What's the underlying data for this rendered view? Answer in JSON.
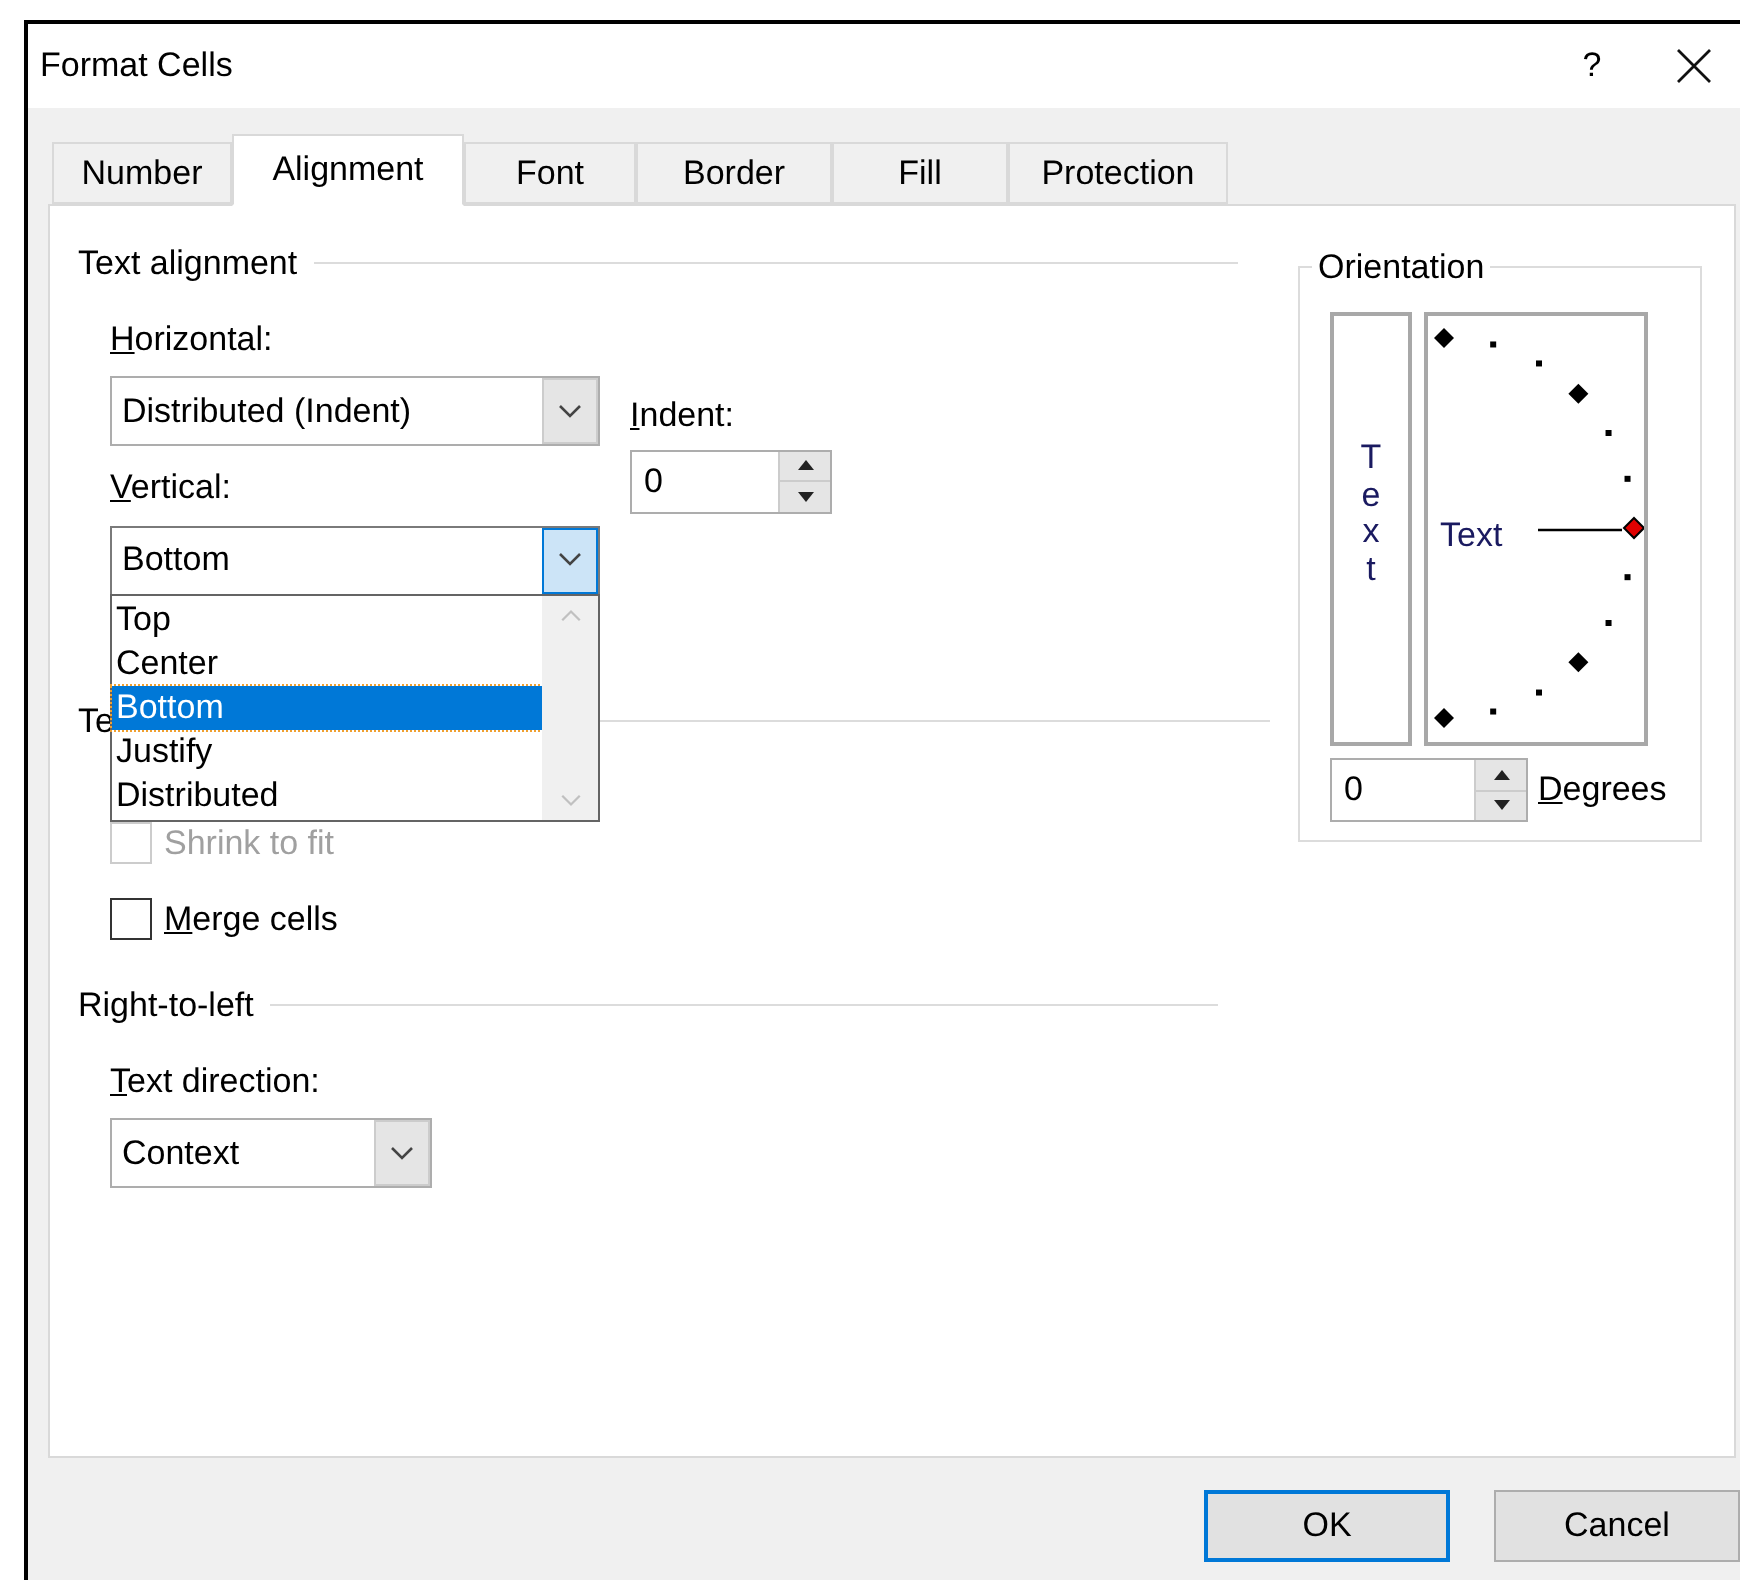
{
  "window": {
    "title": "Format Cells",
    "help": "?"
  },
  "tabs": [
    {
      "label": "Number",
      "selected": false
    },
    {
      "label": "Alignment",
      "selected": true
    },
    {
      "label": "Font",
      "selected": false
    },
    {
      "label": "Border",
      "selected": false
    },
    {
      "label": "Fill",
      "selected": false
    },
    {
      "label": "Protection",
      "selected": false
    }
  ],
  "text_alignment": {
    "heading": "Text alignment",
    "horizontal": {
      "label": {
        "key": "H",
        "rest": "orizontal:"
      },
      "value": "Distributed (Indent)"
    },
    "indent": {
      "label": {
        "key": "I",
        "rest": "ndent:"
      },
      "value": "0"
    },
    "vertical": {
      "label": {
        "key": "V",
        "rest": "ertical:"
      },
      "value": "Bottom",
      "expanded": true,
      "options": [
        {
          "label": "Top",
          "selected": false
        },
        {
          "label": "Center",
          "selected": false
        },
        {
          "label": "Bottom",
          "selected": true
        },
        {
          "label": "Justify",
          "selected": false
        },
        {
          "label": "Distributed",
          "selected": false
        }
      ]
    }
  },
  "text_control": {
    "heading": "Te",
    "items": [
      {
        "label": {
          "rest": "Shrink to fit"
        },
        "checked": false,
        "disabled": true
      },
      {
        "label": {
          "key": "M",
          "rest": "erge cells"
        },
        "checked": false,
        "disabled": false
      }
    ]
  },
  "right_to_left": {
    "heading": "Right-to-left",
    "text_direction": {
      "label": {
        "key": "T",
        "rest": "ext direction:"
      },
      "value": "Context"
    }
  },
  "orientation": {
    "heading": "Orientation",
    "vertical_text": "Text",
    "dial_label": "Text",
    "degrees": {
      "value": "0",
      "label": {
        "key": "D",
        "rest": "egrees"
      }
    }
  },
  "buttons": [
    {
      "label": "OK",
      "focused": true
    },
    {
      "label": "Cancel",
      "focused": false
    }
  ]
}
